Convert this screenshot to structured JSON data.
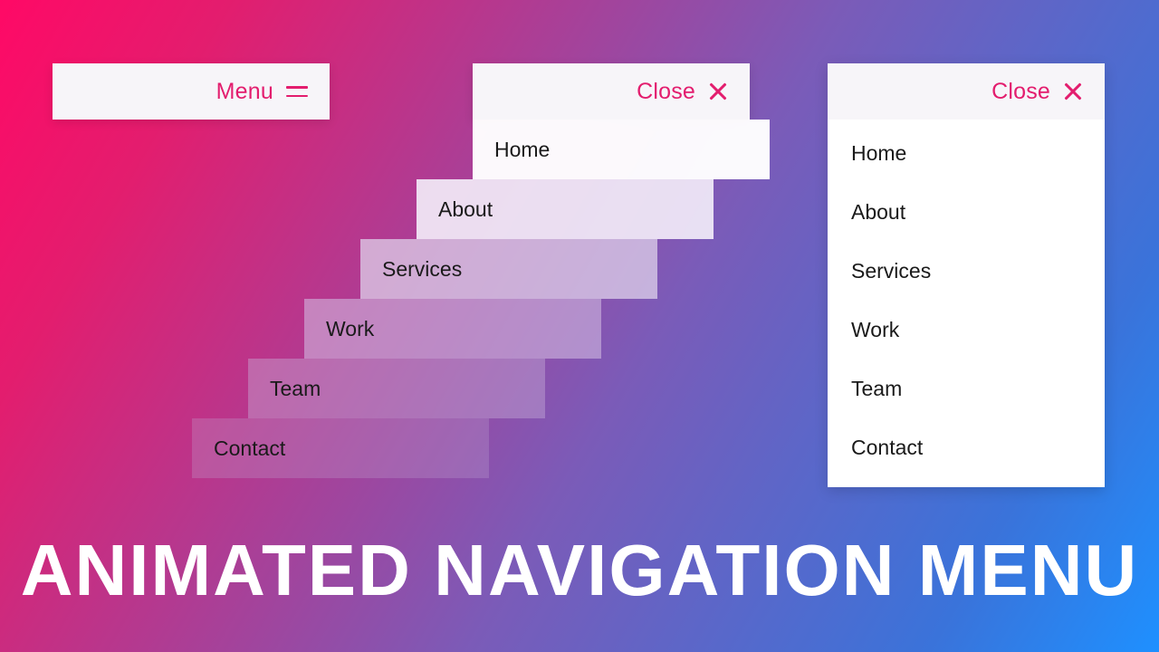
{
  "title": "ANIMATED NAVIGATION MENU",
  "menu": {
    "open_label": "Menu",
    "close_label": "Close",
    "items": [
      "Home",
      "About",
      "Services",
      "Work",
      "Team",
      "Contact"
    ]
  },
  "stagger": {
    "step_x": -62,
    "step_y": 66,
    "bg": [
      "rgba(255,255,255,.97)",
      "rgba(244,238,249,.90)",
      "rgba(222,210,235,.74)",
      "rgba(210,188,225,.58)",
      "rgba(200,176,218,.42)",
      "rgba(195,170,212,.28)"
    ]
  }
}
